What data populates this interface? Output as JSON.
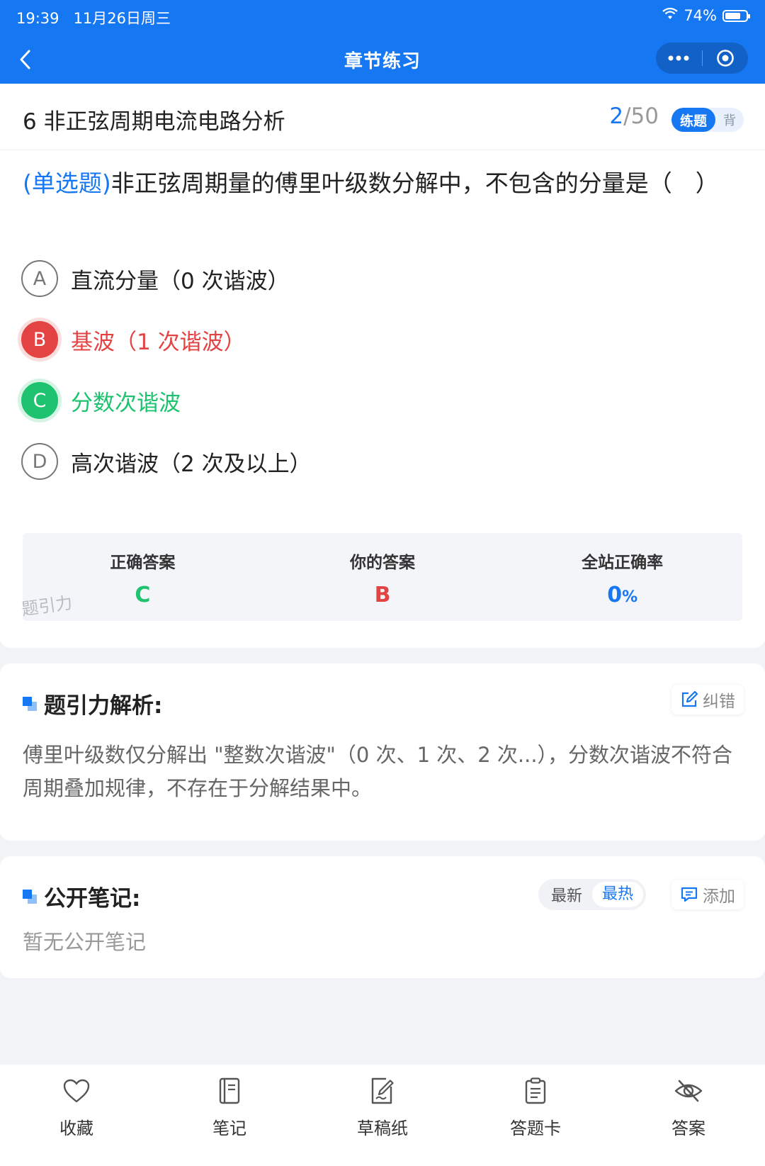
{
  "status_bar": {
    "time": "19:39",
    "date": "11月26日周三",
    "battery": "74%",
    "battery_level": 0.74
  },
  "nav": {
    "title": "章节练习",
    "more_icon": "more-dots-icon",
    "close_icon": "target-circle-icon",
    "back_icon": "chevron-left-icon"
  },
  "chapter": {
    "title": "6 非正弦周期电流电路分析",
    "current": "2",
    "total": "/50",
    "mode_active": "练题",
    "mode_inactive": "背"
  },
  "question": {
    "type": "(单选题)",
    "text": "非正弦周期量的傅里叶级数分解中，不包含的分量是（　）",
    "options": [
      {
        "letter": "A",
        "text": "直流分量（0 次谐波）",
        "state": "normal"
      },
      {
        "letter": "B",
        "text": "基波（1 次谐波）",
        "state": "wrong"
      },
      {
        "letter": "C",
        "text": "分数次谐波",
        "state": "correct"
      },
      {
        "letter": "D",
        "text": "高次谐波（2 次及以上）",
        "state": "normal"
      }
    ]
  },
  "answer_panel": {
    "correct_label": "正确答案",
    "correct_value": "C",
    "your_label": "你的答案",
    "your_value": "B",
    "rate_label": "全站正确率",
    "rate_value": "0",
    "rate_unit": "%"
  },
  "watermark": "题引力",
  "analysis": {
    "title": "题引力解析:",
    "report_label": "纠错",
    "text": "傅里叶级数仅分解出 \"整数次谐波\"（0 次、1 次、2 次...），分数次谐波不符合周期叠加规律，不存在于分解结果中。"
  },
  "notes": {
    "title": "公开笔记:",
    "sort_latest": "最新",
    "sort_hot": "最热",
    "add_label": "添加",
    "empty_text": "暂无公开笔记"
  },
  "tabbar": [
    {
      "label": "收藏",
      "icon": "heart-icon"
    },
    {
      "label": "笔记",
      "icon": "notebook-icon"
    },
    {
      "label": "草稿纸",
      "icon": "draft-pen-icon"
    },
    {
      "label": "答题卡",
      "icon": "answer-sheet-icon"
    },
    {
      "label": "答案",
      "icon": "eye-off-icon"
    }
  ],
  "colors": {
    "primary": "#1677f2",
    "correct": "#1ec26f",
    "wrong": "#e44343"
  }
}
